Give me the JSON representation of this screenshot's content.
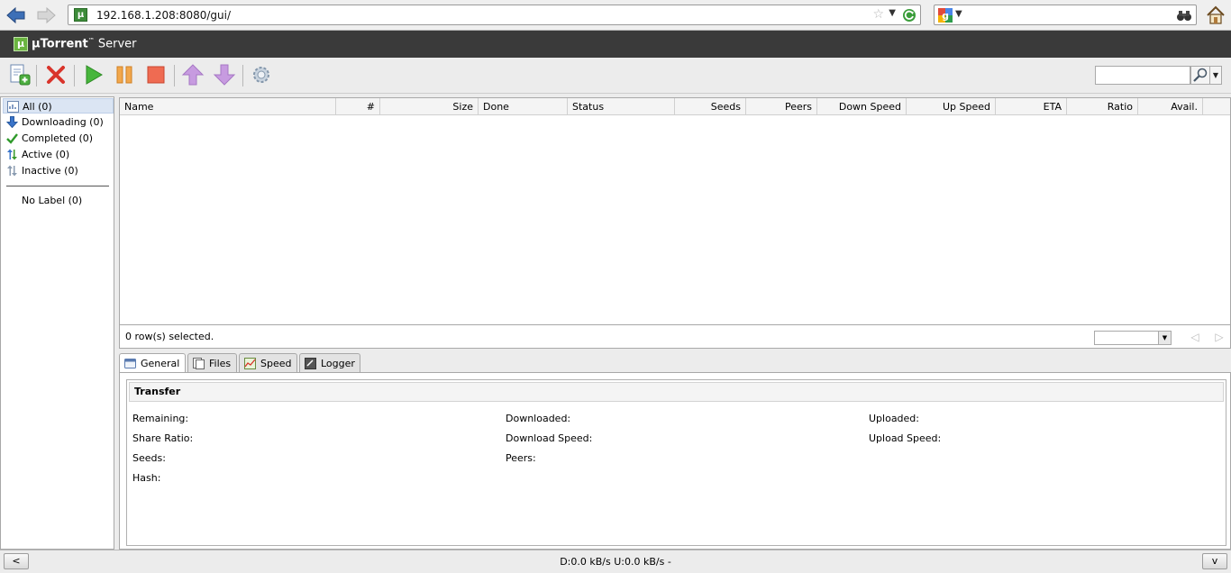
{
  "browser": {
    "url": "192.168.1.208:8080/gui/",
    "search_value": ""
  },
  "app": {
    "title_bold": "µTorrent",
    "title_tm": "™",
    "title_rest": " Server"
  },
  "toolbar": {
    "buttons": [
      "add-torrent",
      "remove",
      "start",
      "pause",
      "stop",
      "move-up",
      "move-down",
      "settings"
    ],
    "search_value": ""
  },
  "categories": [
    {
      "label": "All (0)",
      "selected": true
    },
    {
      "label": "Downloading (0)"
    },
    {
      "label": "Completed (0)"
    },
    {
      "label": "Active (0)"
    },
    {
      "label": "Inactive (0)"
    }
  ],
  "labels": [
    {
      "label": "No Label (0)"
    }
  ],
  "list": {
    "columns": [
      "Name",
      "#",
      "Size",
      "Done",
      "Status",
      "Seeds",
      "Peers",
      "Down Speed",
      "Up Speed",
      "ETA",
      "Ratio",
      "Avail."
    ],
    "rows": [],
    "status_text": "0 row(s) selected."
  },
  "tabs": [
    "General",
    "Files",
    "Speed",
    "Logger"
  ],
  "general": {
    "section": "Transfer",
    "fields": {
      "remaining": "Remaining:",
      "downloaded": "Downloaded:",
      "uploaded": "Uploaded:",
      "share_ratio": "Share Ratio:",
      "download_speed": "Download Speed:",
      "upload_speed": "Upload Speed:",
      "seeds": "Seeds:",
      "peers": "Peers:",
      "hash": "Hash:"
    }
  },
  "statusbar": {
    "left_button": "<",
    "right_button": "v",
    "text": "D:0.0 kB/s U:0.0 kB/s -"
  },
  "colors": {
    "header_bg": "#3a3a3a",
    "selection": "#dbe5f3",
    "start_green": "#47b63c",
    "pause_orange": "#f2a74b",
    "remove_red": "#d9342b",
    "queue_purple": "#c79be0"
  }
}
